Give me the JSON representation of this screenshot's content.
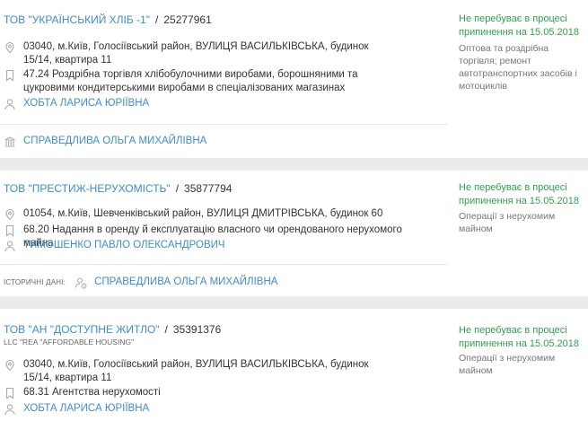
{
  "companies": [
    {
      "name": "ТОВ \"УКРАЇНСЬКИЙ ХЛІБ -1\"",
      "code": "25277961",
      "address": "03040, м.Київ, Голосіївський район, ВУЛИЦЯ ВАСИЛЬКІВСЬКА, будинок 15/14, квартира 11",
      "kved": "47.24 Роздрібна торгівля хлібобулочними виробами, борошняними та цукровими кондитерськими виробами в спеціалізованих магазинах",
      "head": "ХОБТА ЛАРИСА ЮРІЇВНА",
      "status": "Не перебуває в процесі припинення на 15.05.2018",
      "activity": "Оптова та роздрібна торгівля; ремонт автотранспортних засобів і мотоциклів",
      "founder": "СПРАВЕДЛИВА ОЛЬГА МИХАЙЛІВНА"
    },
    {
      "name": "ТОВ \"ПРЕСТИЖ-НЕРУХОМІСТЬ\"",
      "code": "35877794",
      "address": "01054, м.Київ, Шевченківський район, ВУЛИЦЯ ДМИТРІВСЬКА, будинок 60",
      "kved": "68.20 Надання в оренду й експлуатацію власного чи орендованого нерухомого майна",
      "head": "ТИМОШЕНКО ПАВЛО ОЛЕКСАНДРОВИЧ",
      "status": "Не перебуває в процесі припинення на 15.05.2018",
      "activity": "Операції з нерухомим майном",
      "historical_label": "ІСТОРИЧНІ ДАНІ:",
      "historical_person": "СПРАВЕДЛИВА ОЛЬГА МИХАЙЛІВНА"
    },
    {
      "name": "ТОВ \"АН \"ДОСТУПНЕ ЖИТЛО\"",
      "code": "35391376",
      "english_name": "LLC \"REA \"AFFORDABLE HOUSING\"",
      "address": "03040, м.Київ, Голосіївський район, ВУЛИЦЯ ВАСИЛЬКІВСЬКА, будинок 15/14, квартира 11",
      "kved": "68.31 Агентства нерухомості",
      "head": "ХОБТА ЛАРИСА ЮРІЇВНА",
      "status": "Не перебуває в процесі припинення на 15.05.2018",
      "activity": "Операції з нерухомим майном"
    }
  ],
  "colors": {
    "link": "#3c8dcb",
    "status": "#2fa24a",
    "separator": "#ebebeb"
  }
}
